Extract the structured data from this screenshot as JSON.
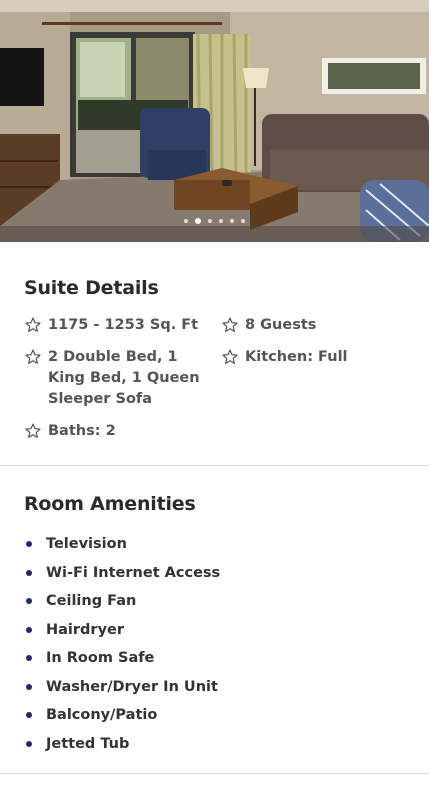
{
  "gallery": {
    "slide_count": 6,
    "active_index": 1
  },
  "suite_details": {
    "title": "Suite Details",
    "items": [
      {
        "icon": "star-icon",
        "text": "1175 - 1253 Sq. Ft"
      },
      {
        "icon": "star-icon",
        "text": "8 Guests"
      },
      {
        "icon": "star-icon",
        "text": "2 Double Bed, 1 King Bed, 1 Queen Sleeper Sofa"
      },
      {
        "icon": "star-icon",
        "text": "Kitchen: Full"
      },
      {
        "icon": "star-icon",
        "text": "Baths: 2"
      }
    ]
  },
  "room_amenities": {
    "title": "Room Amenities",
    "items": [
      "Television",
      "Wi-Fi Internet Access",
      "Ceiling Fan",
      "Hairdryer",
      "In Room Safe",
      "Washer/Dryer In Unit",
      "Balcony/Patio",
      "Jetted Tub"
    ]
  },
  "colors": {
    "bullet": "#1f2a6b",
    "text": "#333333",
    "divider": "#dddddd"
  }
}
